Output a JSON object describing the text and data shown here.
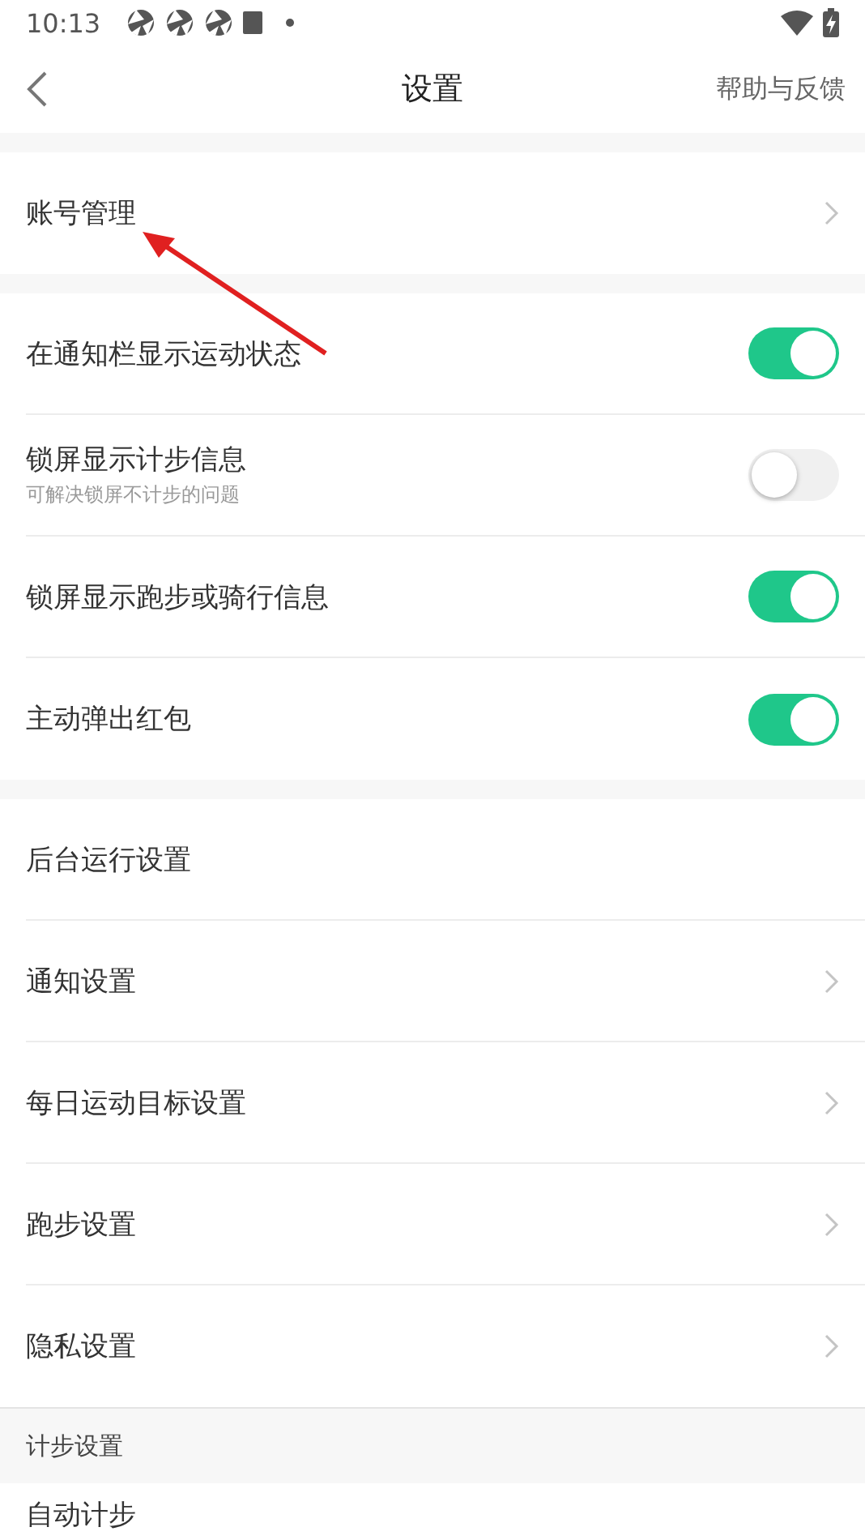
{
  "status_bar": {
    "time": "10:13"
  },
  "nav": {
    "title": "设置",
    "action": "帮助与反馈"
  },
  "groups": [
    {
      "items": [
        {
          "kind": "link",
          "label": "账号管理",
          "chevron": true
        }
      ]
    },
    {
      "items": [
        {
          "kind": "toggle",
          "label": "在通知栏显示运动状态",
          "on": true
        },
        {
          "kind": "toggle",
          "label": "锁屏显示计步信息",
          "subtitle": "可解决锁屏不计步的问题",
          "on": false
        },
        {
          "kind": "toggle",
          "label": "锁屏显示跑步或骑行信息",
          "on": true
        },
        {
          "kind": "toggle",
          "label": "主动弹出红包",
          "on": true
        }
      ]
    },
    {
      "items": [
        {
          "kind": "link",
          "label": "后台运行设置",
          "chevron": false
        },
        {
          "kind": "link",
          "label": "通知设置",
          "chevron": true
        },
        {
          "kind": "link",
          "label": "每日运动目标设置",
          "chevron": true
        },
        {
          "kind": "link",
          "label": "跑步设置",
          "chevron": true
        },
        {
          "kind": "link",
          "label": "隐私设置",
          "chevron": true
        }
      ]
    }
  ],
  "section_header": "计步设置",
  "last_row": {
    "label": "自动计步"
  }
}
